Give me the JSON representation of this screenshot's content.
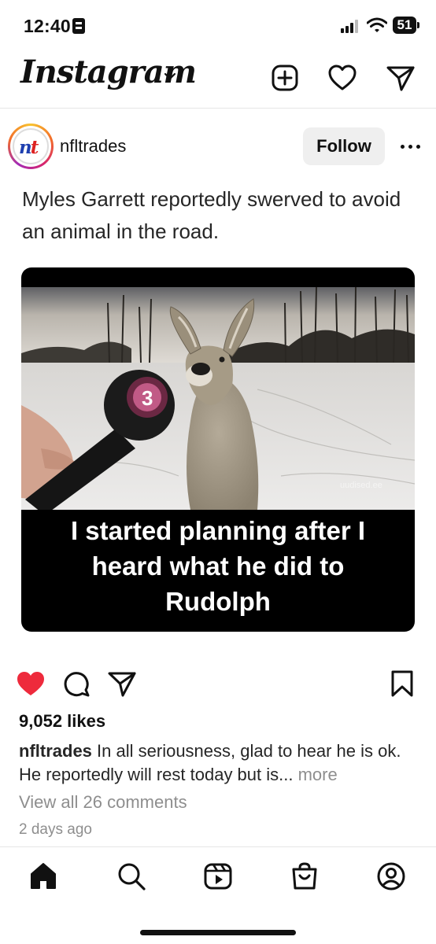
{
  "status_bar": {
    "time": "12:40",
    "battery": "51",
    "icons": [
      "sim-icon",
      "signal-icon",
      "wifi-icon",
      "battery-icon"
    ]
  },
  "header": {
    "logo": "Instagram",
    "icons": [
      "chevron-down-icon",
      "new-post-icon",
      "heart-icon",
      "direct-message-icon"
    ]
  },
  "post": {
    "username": "nfltrades",
    "follow_label": "Follow",
    "text": "Myles Garrett reportedly swerved to avoid an animal in the road.",
    "meme": {
      "caption_line1": "I started planning after I",
      "caption_line2": "heard what he did to",
      "caption_line3": "Rudolph",
      "watermark": "uudised.ee",
      "mic_number": "3"
    },
    "likes": "9,052 likes",
    "caption_user": "nfltrades",
    "caption_text": "In all seriousness, glad to hear he is ok. He reportedly will rest today but is...",
    "caption_more": "more",
    "view_comments": "View all 26 comments",
    "time": "2 days ago"
  },
  "bottom_nav": {
    "icons": [
      "home-icon",
      "search-icon",
      "reels-icon",
      "shop-icon",
      "profile-icon"
    ]
  },
  "colors": {
    "like_red": "#ee2a3c",
    "secondary_text": "#8e8e8e",
    "follow_bg": "#efefef"
  }
}
